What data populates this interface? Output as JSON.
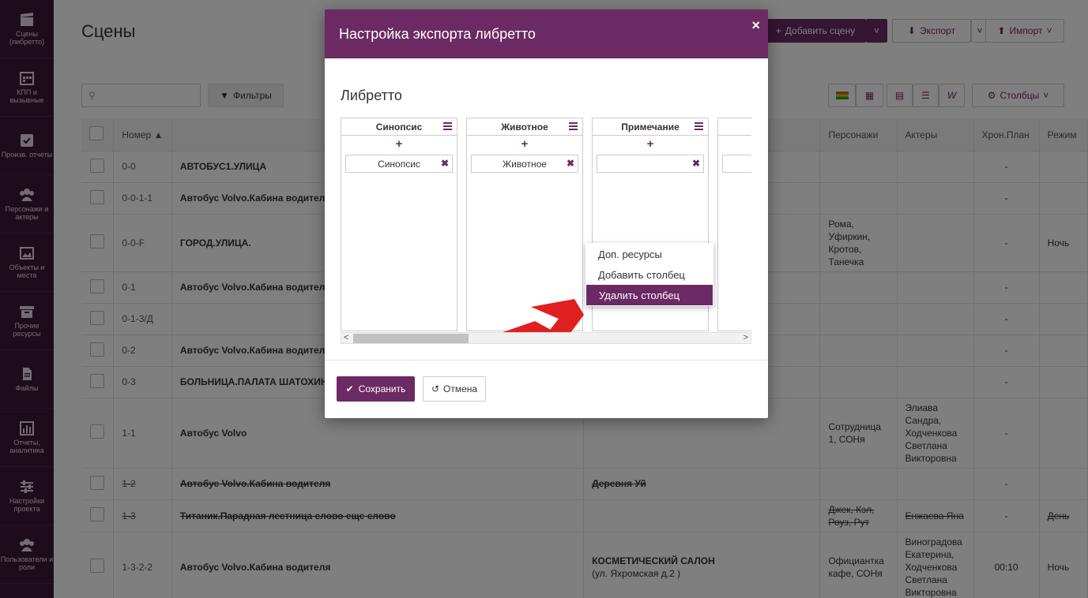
{
  "sidebar": {
    "items": [
      {
        "label": "Сцены (либретто)",
        "icon": "clapperboard-icon"
      },
      {
        "label": "КПП и вызывные",
        "icon": "calendar-icon"
      },
      {
        "label": "Произв. отчеты",
        "icon": "check-square-icon"
      },
      {
        "label": "Персонажи и актеры",
        "icon": "users-icon"
      },
      {
        "label": "Объекты и места",
        "icon": "image-icon"
      },
      {
        "label": "Прочие ресурсы",
        "icon": "archive-icon"
      },
      {
        "label": "Файлы",
        "icon": "file-icon"
      },
      {
        "label": "Отчеты, аналитика",
        "icon": "bar-chart-icon"
      },
      {
        "label": "Настройки проекта",
        "icon": "sliders-icon"
      },
      {
        "label": "Пользователи и роли",
        "icon": "users-icon"
      }
    ]
  },
  "page": {
    "title": "Сцены",
    "add_scene": "Добавить сцену",
    "export": "Экспорт",
    "import": "Импорт",
    "filters": "Фильтры",
    "columns": "Столбцы"
  },
  "table": {
    "headers": {
      "number": "Номер",
      "characters": "Персонажи",
      "actors": "Актеры",
      "chron": "Хрон.План",
      "mode": "Режим"
    },
    "rows": [
      {
        "num": "0-0",
        "name": "АВТОБУС1.УЛИЦА",
        "loc": "",
        "chars": "",
        "actors": "",
        "chron": "-",
        "mode": "",
        "struck": false
      },
      {
        "num": "0-0-1-1",
        "name": "Автобус Volvo.Кабина водителя",
        "loc": "",
        "chars": "",
        "actors": "",
        "chron": "-",
        "mode": "",
        "struck": false
      },
      {
        "num": "0-0-F",
        "name": "ГОРОД.УЛИЦА.",
        "loc": "",
        "chars": "Рома, Уфиркин, Кротов, Танечка",
        "actors": "",
        "chron": "-",
        "mode": "Ночь",
        "struck": false
      },
      {
        "num": "0-1",
        "name": "Автобус Volvo.Кабина водителя",
        "loc": "",
        "chars": "",
        "actors": "",
        "chron": "-",
        "mode": "",
        "struck": false
      },
      {
        "num": "0-1-3/Д",
        "name": "",
        "loc": "",
        "chars": "",
        "actors": "",
        "chron": "-",
        "mode": "",
        "struck": false
      },
      {
        "num": "0-2",
        "name": "Автобус Volvo.Кабина водителя",
        "loc": "",
        "chars": "",
        "actors": "",
        "chron": "-",
        "mode": "",
        "struck": false
      },
      {
        "num": "0-3",
        "name": "БОЛЬНИЦА.ПАЛАТА ШАТОХИНА",
        "loc": "",
        "chars": "",
        "actors": "",
        "chron": "-",
        "mode": "",
        "struck": false
      },
      {
        "num": "1-1",
        "name": "Автобус Volvo",
        "loc": "",
        "chars": "Сотрудница 1, СОНя",
        "actors": "Элиава Сандра, Ходченкова Светлана Викторовна",
        "chron": "-",
        "mode": "",
        "struck": false
      },
      {
        "num": "1-2",
        "name": "Автобус Volvo.Кабина водителя",
        "loc": "Деревня Уй",
        "chars": "",
        "actors": "",
        "chron": "-",
        "mode": "",
        "struck": true
      },
      {
        "num": "1-3",
        "name": "Титаник.Парадная лестница слово еще слово",
        "loc": "",
        "chars": "Джек, Кэл, Роуз, Рут",
        "actors": "Енжаева Яна",
        "chron": "-",
        "mode": "День",
        "struck": true
      },
      {
        "num": "1-3-2-2",
        "name": "Автобус Volvo.Кабина водителя",
        "loc": "КОСМЕТИЧЕСКИЙ САЛОН",
        "loc2": "(ул. Яхромская д.2 )",
        "chars": "Официантка кафе, СОНя",
        "actors": "Виноградова Екатерина, Ходченкова Светлана Викторовна",
        "chron": "00:10",
        "mode": "Ночь",
        "struck": false
      }
    ]
  },
  "modal": {
    "title": "Настройка экспорта либретто",
    "close": "×",
    "subtitle": "Либретто",
    "columns": [
      {
        "title": "Синопсис",
        "field": "Синопсис"
      },
      {
        "title": "Животное",
        "field": "Животное"
      },
      {
        "title": "Примечание",
        "field": ""
      }
    ],
    "add": "+",
    "context_menu": [
      "Доп. ресурсы",
      "Добавить столбец",
      "Удалить столбец"
    ],
    "save": "Сохранить",
    "cancel": "Отмена"
  },
  "colors": {
    "brand": "#6b2a63",
    "sidebar": "#3b1a36",
    "logo": "#e02020"
  }
}
